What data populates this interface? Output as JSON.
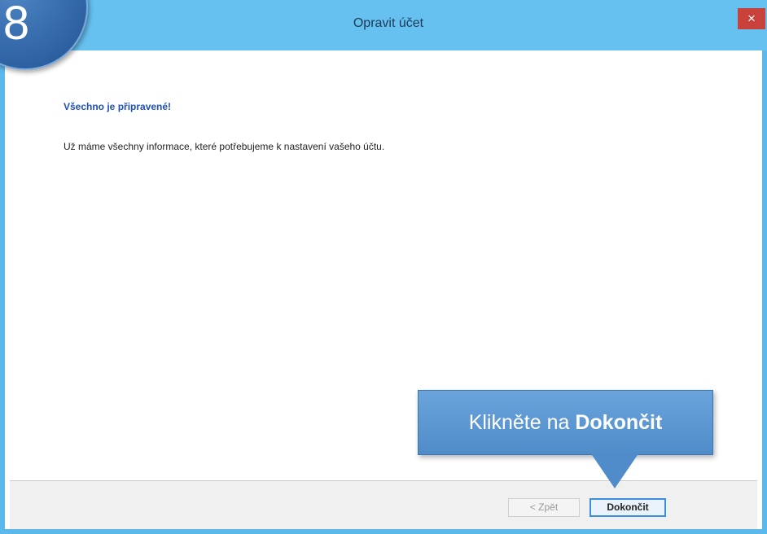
{
  "step_badge": {
    "number": "8"
  },
  "window": {
    "title": "Opravit účet",
    "close_glyph": "×"
  },
  "content": {
    "heading": "Všechno je připravené!",
    "message": "Už máme všechny informace, které potřebujeme k nastavení vašeho účtu."
  },
  "buttons": {
    "back_label": "< Zpět",
    "finish_label": "Dokončit"
  },
  "callout": {
    "prefix": "Klikněte na ",
    "emphasis": "Dokončit"
  },
  "colors": {
    "titlebar": "#66c0f0",
    "close_button": "#c8423b",
    "heading_text": "#1f4fbf",
    "callout": "#4f8cc9",
    "badge": "#2e62a3"
  }
}
